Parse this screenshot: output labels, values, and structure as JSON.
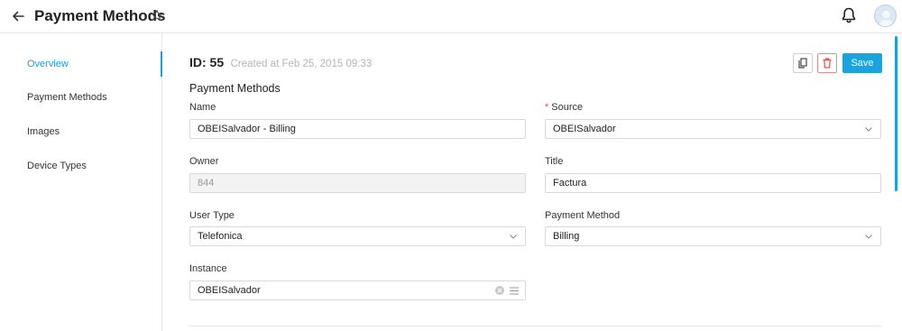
{
  "header": {
    "title": "Payment Methods"
  },
  "sidebar": {
    "items": [
      {
        "label": "Overview",
        "active": true
      },
      {
        "label": "Payment Methods",
        "active": false
      },
      {
        "label": "Images",
        "active": false
      },
      {
        "label": "Device Types",
        "active": false
      }
    ]
  },
  "record": {
    "id_label": "ID: 55",
    "created": "Created at Feb 25, 2015 09:33"
  },
  "toolbar": {
    "save_label": "Save"
  },
  "form": {
    "section_title": "Payment Methods",
    "name": {
      "label": "Name",
      "value": "OBEISalvador - Billing"
    },
    "source": {
      "label": "Source",
      "required": true,
      "value": "OBEISalvador"
    },
    "owner": {
      "label": "Owner",
      "value": "844",
      "disabled": true
    },
    "title": {
      "label": "Title",
      "value": "Factura"
    },
    "user_type": {
      "label": "User Type",
      "value": "Telefonica"
    },
    "payment_method": {
      "label": "Payment Method",
      "value": "Billing"
    },
    "instance": {
      "label": "Instance",
      "value": "OBEISalvador"
    }
  },
  "colors": {
    "accent": "#1aa4dd",
    "danger": "#e0504a"
  },
  "icons": [
    "back-arrow-icon",
    "star-icon",
    "bell-icon",
    "user-avatar-icon",
    "copy-icon",
    "trash-icon",
    "chevron-down-icon",
    "clear-icon",
    "list-icon"
  ]
}
